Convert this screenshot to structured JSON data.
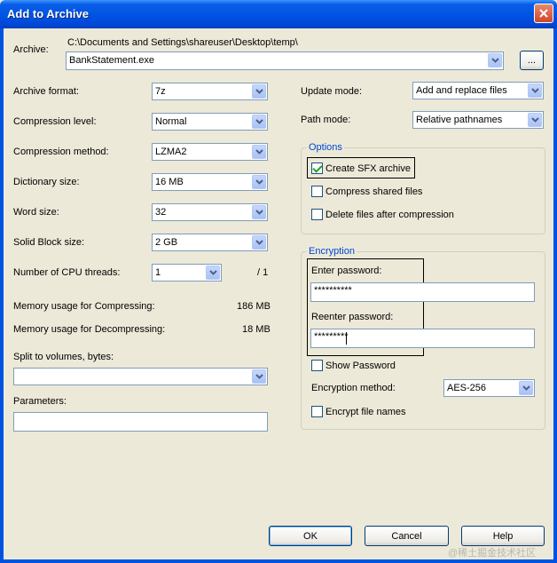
{
  "window": {
    "title": "Add to Archive"
  },
  "archive": {
    "label": "Archive:",
    "path": "C:\\Documents and Settings\\shareuser\\Desktop\\temp\\",
    "filename": "BankStatement.exe",
    "browse_label": "..."
  },
  "left": {
    "format": {
      "label": "Archive format:",
      "value": "7z"
    },
    "level": {
      "label": "Compression level:",
      "value": "Normal"
    },
    "method": {
      "label": "Compression method:",
      "value": "LZMA2"
    },
    "dict": {
      "label": "Dictionary size:",
      "value": "16 MB"
    },
    "word": {
      "label": "Word size:",
      "value": "32"
    },
    "solid": {
      "label": "Solid Block size:",
      "value": "2 GB"
    },
    "threads": {
      "label": "Number of CPU threads:",
      "value": "1",
      "total": "/ 1"
    },
    "mem_compress": {
      "label": "Memory usage for Compressing:",
      "value": "186 MB"
    },
    "mem_decompress": {
      "label": "Memory usage for Decompressing:",
      "value": "18 MB"
    },
    "split": {
      "label": "Split to volumes, bytes:",
      "value": ""
    },
    "params": {
      "label": "Parameters:",
      "value": ""
    }
  },
  "right": {
    "update": {
      "label": "Update mode:",
      "value": "Add and replace files"
    },
    "pathmode": {
      "label": "Path mode:",
      "value": "Relative pathnames"
    },
    "options": {
      "title": "Options",
      "sfx": {
        "label": "Create SFX archive",
        "checked": true
      },
      "shared": {
        "label": "Compress shared files",
        "checked": false
      },
      "delete": {
        "label": "Delete files after compression",
        "checked": false
      }
    },
    "encryption": {
      "title": "Encryption",
      "enter_label": "Enter password:",
      "enter_value": "**********",
      "reenter_label": "Reenter password:",
      "reenter_value": "*********",
      "show_password": "Show Password",
      "method_label": "Encryption method:",
      "method_value": "AES-256",
      "encrypt_names": "Encrypt file names"
    }
  },
  "buttons": {
    "ok": "OK",
    "cancel": "Cancel",
    "help": "Help"
  },
  "watermark": "@稀土掘金技术社区",
  "colors": {
    "titlebar": "#0055e5",
    "dialog_bg": "#ece9d8",
    "group_title": "#0046d5",
    "check": "#21a121"
  }
}
